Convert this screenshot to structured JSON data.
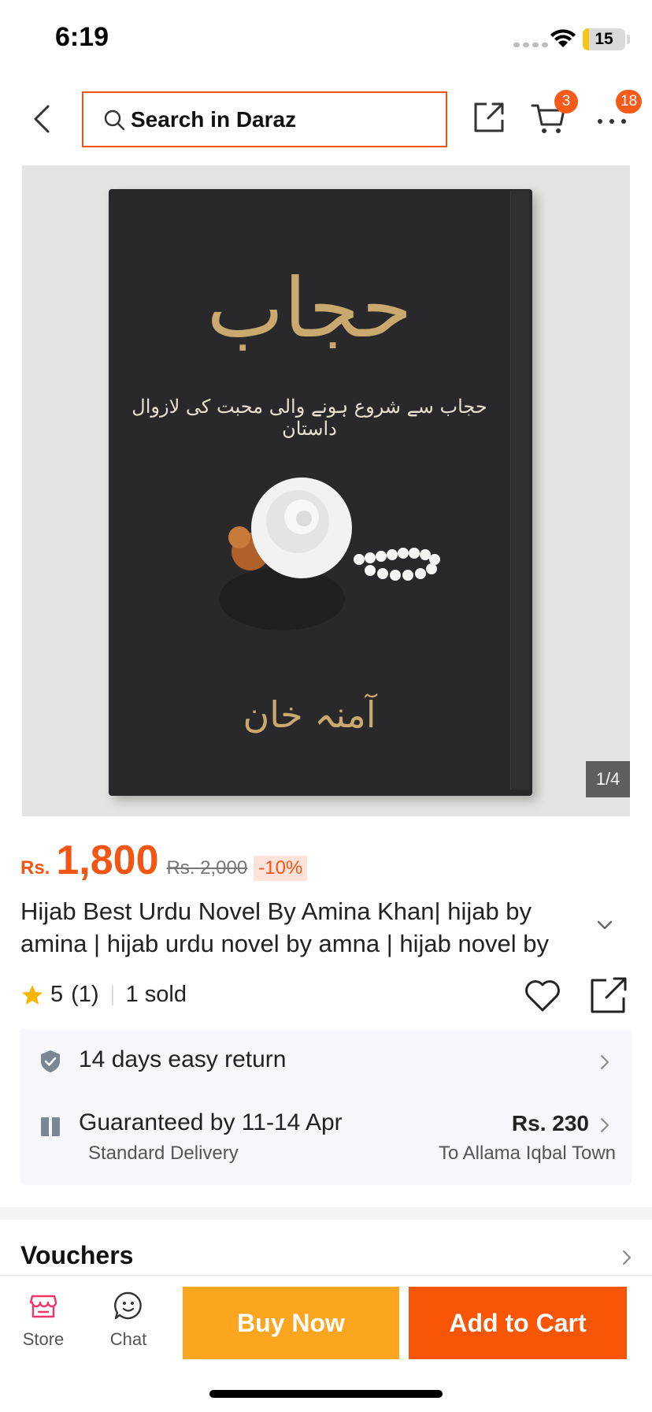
{
  "status_bar": {
    "time": "6:19",
    "battery": "15",
    "battery_level": 0.15
  },
  "header": {
    "search_placeholder": "Search in Daraz",
    "cart_badge": "3",
    "more_badge": "18"
  },
  "gallery": {
    "counter": "1/4",
    "book_title": "حجاب",
    "book_subtitle": "حجاب سے شروع ہونے والی محبت کی لازوال داستان",
    "book_author": "آمنہ خان"
  },
  "price": {
    "currency": "Rs.",
    "value": "1,800",
    "original": "Rs. 2,000",
    "discount": "-10%"
  },
  "product": {
    "title": "Hijab Best Urdu Novel By Amina Khan| hijab by amina | hijab urdu novel by amna |  hijab novel by amna khan"
  },
  "rating": {
    "score": "5",
    "count": "(1)",
    "sold": "1 sold"
  },
  "service": {
    "return_text": "14 days easy return",
    "delivery_text": "Guaranteed by 11-14 Apr",
    "delivery_type": "Standard Delivery",
    "delivery_price": "Rs. 230",
    "delivery_dest": "To Allama Iqbal Town"
  },
  "vouchers": {
    "title": "Vouchers"
  },
  "bottom_bar": {
    "store_label": "Store",
    "chat_label": "Chat",
    "buy_now_label": "Buy Now",
    "add_to_cart_label": "Add to Cart"
  },
  "colors": {
    "accent": "#f35614",
    "buy_now": "#fca61f",
    "add_to_cart": "#f85506",
    "badge": "#f85a1a"
  }
}
